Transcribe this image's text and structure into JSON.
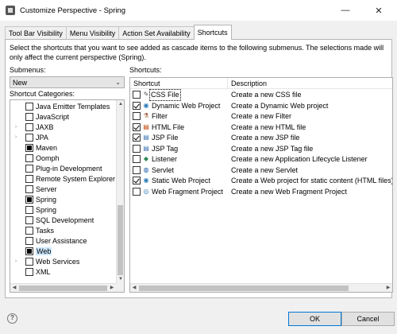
{
  "window": {
    "title": "Customize Perspective - Spring",
    "minimize": "—",
    "close": "✕"
  },
  "tabs": [
    {
      "label": "Tool Bar Visibility"
    },
    {
      "label": "Menu Visibility"
    },
    {
      "label": "Action Set Availability"
    },
    {
      "label": "Shortcuts"
    }
  ],
  "active_tab": "Shortcuts",
  "description": "Select the shortcuts that you want to see added as cascade items to the following submenus.  The selections made will only affect the current perspective (Spring).",
  "submenus": {
    "label": "Submenus:",
    "selected": "New"
  },
  "categories": {
    "label": "Shortcut Categories:",
    "items": [
      {
        "label": "Java Emitter Templates",
        "expandable": false,
        "state": "empty"
      },
      {
        "label": "JavaScript",
        "expandable": false,
        "state": "empty"
      },
      {
        "label": "JAXB",
        "expandable": true,
        "state": "empty"
      },
      {
        "label": "JPA",
        "expandable": true,
        "state": "empty"
      },
      {
        "label": "Maven",
        "expandable": false,
        "state": "partial"
      },
      {
        "label": "Oomph",
        "expandable": false,
        "state": "empty"
      },
      {
        "label": "Plug-in Development",
        "expandable": false,
        "state": "empty"
      },
      {
        "label": "Remote System Explorer",
        "expandable": false,
        "state": "empty"
      },
      {
        "label": "Server",
        "expandable": false,
        "state": "empty"
      },
      {
        "label": "Spring",
        "expandable": false,
        "state": "partial"
      },
      {
        "label": "Spring",
        "expandable": false,
        "state": "empty"
      },
      {
        "label": "SQL Development",
        "expandable": false,
        "state": "empty"
      },
      {
        "label": "Tasks",
        "expandable": false,
        "state": "empty"
      },
      {
        "label": "User Assistance",
        "expandable": false,
        "state": "empty"
      },
      {
        "label": "Web",
        "expandable": false,
        "state": "partial",
        "selected": true
      },
      {
        "label": "Web Services",
        "expandable": true,
        "state": "empty"
      },
      {
        "label": "XML",
        "expandable": false,
        "state": "empty"
      }
    ]
  },
  "shortcuts": {
    "label": "Shortcuts:",
    "columns": {
      "shortcut": "Shortcut",
      "description": "Description"
    },
    "rows": [
      {
        "name": "CSS File",
        "description": "Create a new CSS file",
        "checked": false,
        "icon": "css-file-icon",
        "glyph": "✎",
        "cls": "ic-css",
        "focus": true
      },
      {
        "name": "Dynamic Web Project",
        "description": "Create a Dynamic Web project",
        "checked": true,
        "icon": "web-project-icon",
        "glyph": "◉",
        "cls": "ic-web"
      },
      {
        "name": "Filter",
        "description": "Create a new Filter",
        "checked": false,
        "icon": "filter-icon",
        "glyph": "⚗",
        "cls": "ic-filter"
      },
      {
        "name": "HTML File",
        "description": "Create a new HTML file",
        "checked": true,
        "icon": "html-file-icon",
        "glyph": "▤",
        "cls": "ic-html"
      },
      {
        "name": "JSP File",
        "description": "Create a new JSP file",
        "checked": true,
        "icon": "jsp-file-icon",
        "glyph": "▤",
        "cls": "ic-jsp"
      },
      {
        "name": "JSP Tag",
        "description": "Create a new JSP Tag file",
        "checked": false,
        "icon": "jsp-tag-icon",
        "glyph": "▤",
        "cls": "ic-jsp"
      },
      {
        "name": "Listener",
        "description": "Create a new Application Lifecycle Listener",
        "checked": false,
        "icon": "listener-icon",
        "glyph": "◆",
        "cls": "ic-lst"
      },
      {
        "name": "Servlet",
        "description": "Create a new Servlet",
        "checked": false,
        "icon": "servlet-icon",
        "glyph": "◍",
        "cls": "ic-srv"
      },
      {
        "name": "Static Web Project",
        "description": "Create a Web project for static content (HTML files) o",
        "checked": true,
        "icon": "static-web-project-icon",
        "glyph": "◉",
        "cls": "ic-web"
      },
      {
        "name": "Web Fragment Project",
        "description": "Create a new Web Fragment Project",
        "checked": false,
        "icon": "web-fragment-project-icon",
        "glyph": "◎",
        "cls": "ic-web"
      }
    ]
  },
  "buttons": {
    "ok": "OK",
    "cancel": "Cancel",
    "help": "?"
  }
}
